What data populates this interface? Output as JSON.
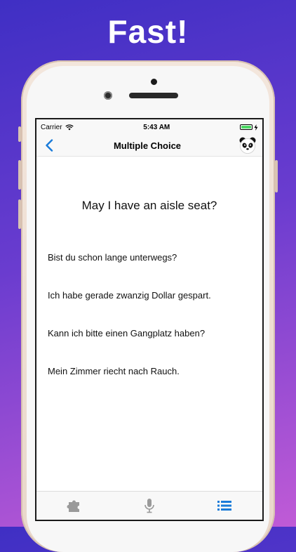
{
  "headline": "Fast!",
  "status": {
    "carrier": "Carrier",
    "time": "5:43 AM"
  },
  "nav": {
    "title": "Multiple Choice"
  },
  "question": "May I have an aisle seat?",
  "choices": [
    "Bist du schon lange unterwegs?",
    "Ich habe gerade zwanzig Dollar gespart.",
    "Kann ich bitte einen Gangplatz haben?",
    "Mein Zimmer riecht nach Rauch."
  ],
  "colors": {
    "accent": "#1a7bd9",
    "tab_inactive": "#9a9a9a",
    "battery": "#4cd964"
  },
  "tabs": [
    {
      "icon": "puzzle-icon",
      "active": false
    },
    {
      "icon": "microphone-icon",
      "active": false
    },
    {
      "icon": "list-icon",
      "active": true
    }
  ]
}
